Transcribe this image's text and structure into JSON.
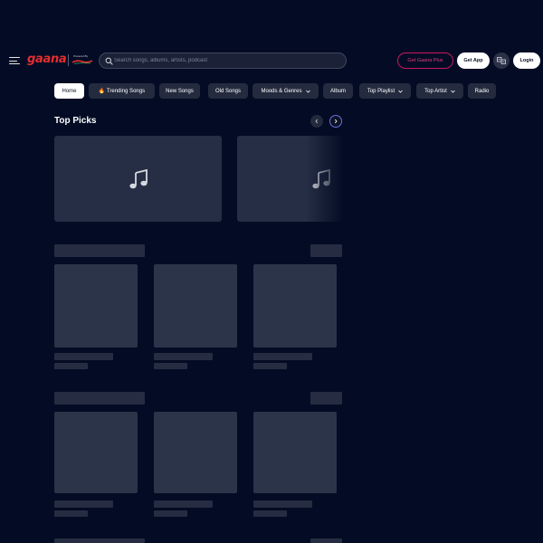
{
  "header": {
    "logo_text": "gaana",
    "powered_by": "Powered By",
    "search_placeholder": "Search songs, albums, artists, podcast",
    "get_plus_label": "Get Gaana Plus",
    "get_app_label": "Get App",
    "login_label": "Login"
  },
  "nav": {
    "items": [
      {
        "label": "Home",
        "active": true,
        "dropdown": false
      },
      {
        "label": "🔥 Trending Songs",
        "active": false,
        "dropdown": false
      },
      {
        "label": "New Songs",
        "active": false,
        "dropdown": false
      },
      {
        "label": "Old Songs",
        "active": false,
        "dropdown": false
      },
      {
        "label": "Moods & Genres",
        "active": false,
        "dropdown": true
      },
      {
        "label": "Album",
        "active": false,
        "dropdown": false
      },
      {
        "label": "Top Playlist",
        "active": false,
        "dropdown": true
      },
      {
        "label": "Top Artist",
        "active": false,
        "dropdown": true
      },
      {
        "label": "Radio",
        "active": false,
        "dropdown": false
      }
    ]
  },
  "top_picks": {
    "title": "Top Picks",
    "card_icon": "music-note-icon"
  },
  "icons": {
    "menu": "hamburger-menu-icon",
    "search": "search-icon",
    "language": "language-icon",
    "prev": "chevron-left-icon",
    "next": "chevron-right-icon"
  },
  "colors": {
    "background": "#030c24",
    "brand_red": "#e72c30",
    "plus_pink": "#c81762",
    "card": "#262e45",
    "skeleton": "#2c3449"
  }
}
